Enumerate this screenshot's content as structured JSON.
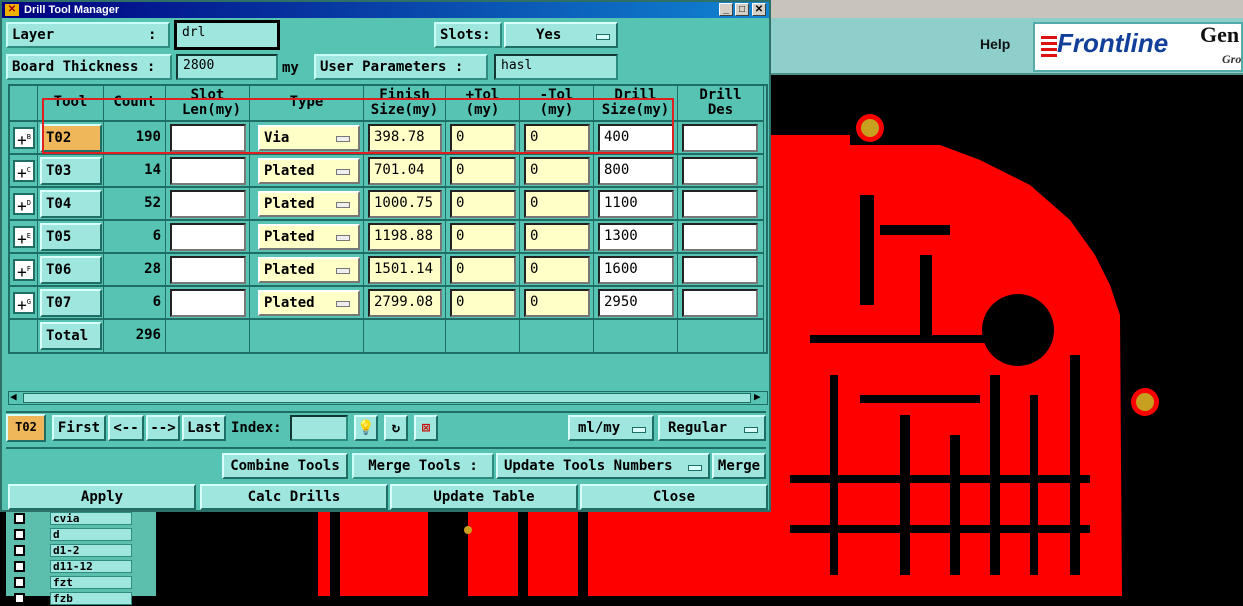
{
  "window": {
    "title": "Drill Tool Manager"
  },
  "header": {
    "layer_label": "Layer",
    "layer_sep": ":",
    "layer_value": "drl",
    "slots_label": "Slots:",
    "slots_value": "Yes",
    "board_label": "Board Thickness :",
    "board_value": "2800",
    "board_unit": "my",
    "user_params_label": "User Parameters :",
    "user_params_value": "hasl"
  },
  "table": {
    "headers": [
      "Tool",
      "Count",
      "Slot Len(my)",
      "Type",
      "Finish Size(my)",
      "+Tol (my)",
      "-Tol (my)",
      "Drill Size(my)",
      "Drill Des"
    ],
    "rows": [
      {
        "tool": "T02",
        "count": "190",
        "type": "Via",
        "finish": "398.78",
        "ptol": "0",
        "mtol": "0",
        "drill": "400"
      },
      {
        "tool": "T03",
        "count": "14",
        "type": "Plated",
        "finish": "701.04",
        "ptol": "0",
        "mtol": "0",
        "drill": "800"
      },
      {
        "tool": "T04",
        "count": "52",
        "type": "Plated",
        "finish": "1000.75",
        "ptol": "0",
        "mtol": "0",
        "drill": "1100"
      },
      {
        "tool": "T05",
        "count": "6",
        "type": "Plated",
        "finish": "1198.88",
        "ptol": "0",
        "mtol": "0",
        "drill": "1300"
      },
      {
        "tool": "T06",
        "count": "28",
        "type": "Plated",
        "finish": "1501.14",
        "ptol": "0",
        "mtol": "0",
        "drill": "1600"
      },
      {
        "tool": "T07",
        "count": "6",
        "type": "Plated",
        "finish": "2799.08",
        "ptol": "0",
        "mtol": "0",
        "drill": "2950"
      }
    ],
    "total_label": "Total",
    "total_count": "296"
  },
  "navbar": {
    "current_tool": "T02",
    "first": "First",
    "prev": "<--",
    "next": "-->",
    "last": "Last",
    "index_label": "Index:",
    "units": "ml/my",
    "mode": "Regular"
  },
  "actions": {
    "combine": "Combine Tools",
    "merge_label": "Merge Tools :",
    "merge_option": "Update Tools Numbers",
    "merge": "Merge",
    "apply": "Apply",
    "calc": "Calc Drills",
    "update": "Update Table",
    "close": "Close"
  },
  "background": {
    "help": "Help",
    "logo": "Frontline",
    "gen": "Gen",
    "gro": "Gro",
    "layers": [
      "cvia",
      "d",
      "d1-2",
      "d11-12",
      "fzt",
      "fzb"
    ]
  },
  "colors": {
    "copper": "#ff0000",
    "pad": "#c8a020",
    "selected_tool": "#f0b65a",
    "panel": "#56c3b3",
    "highlight_box": "#e02020"
  }
}
